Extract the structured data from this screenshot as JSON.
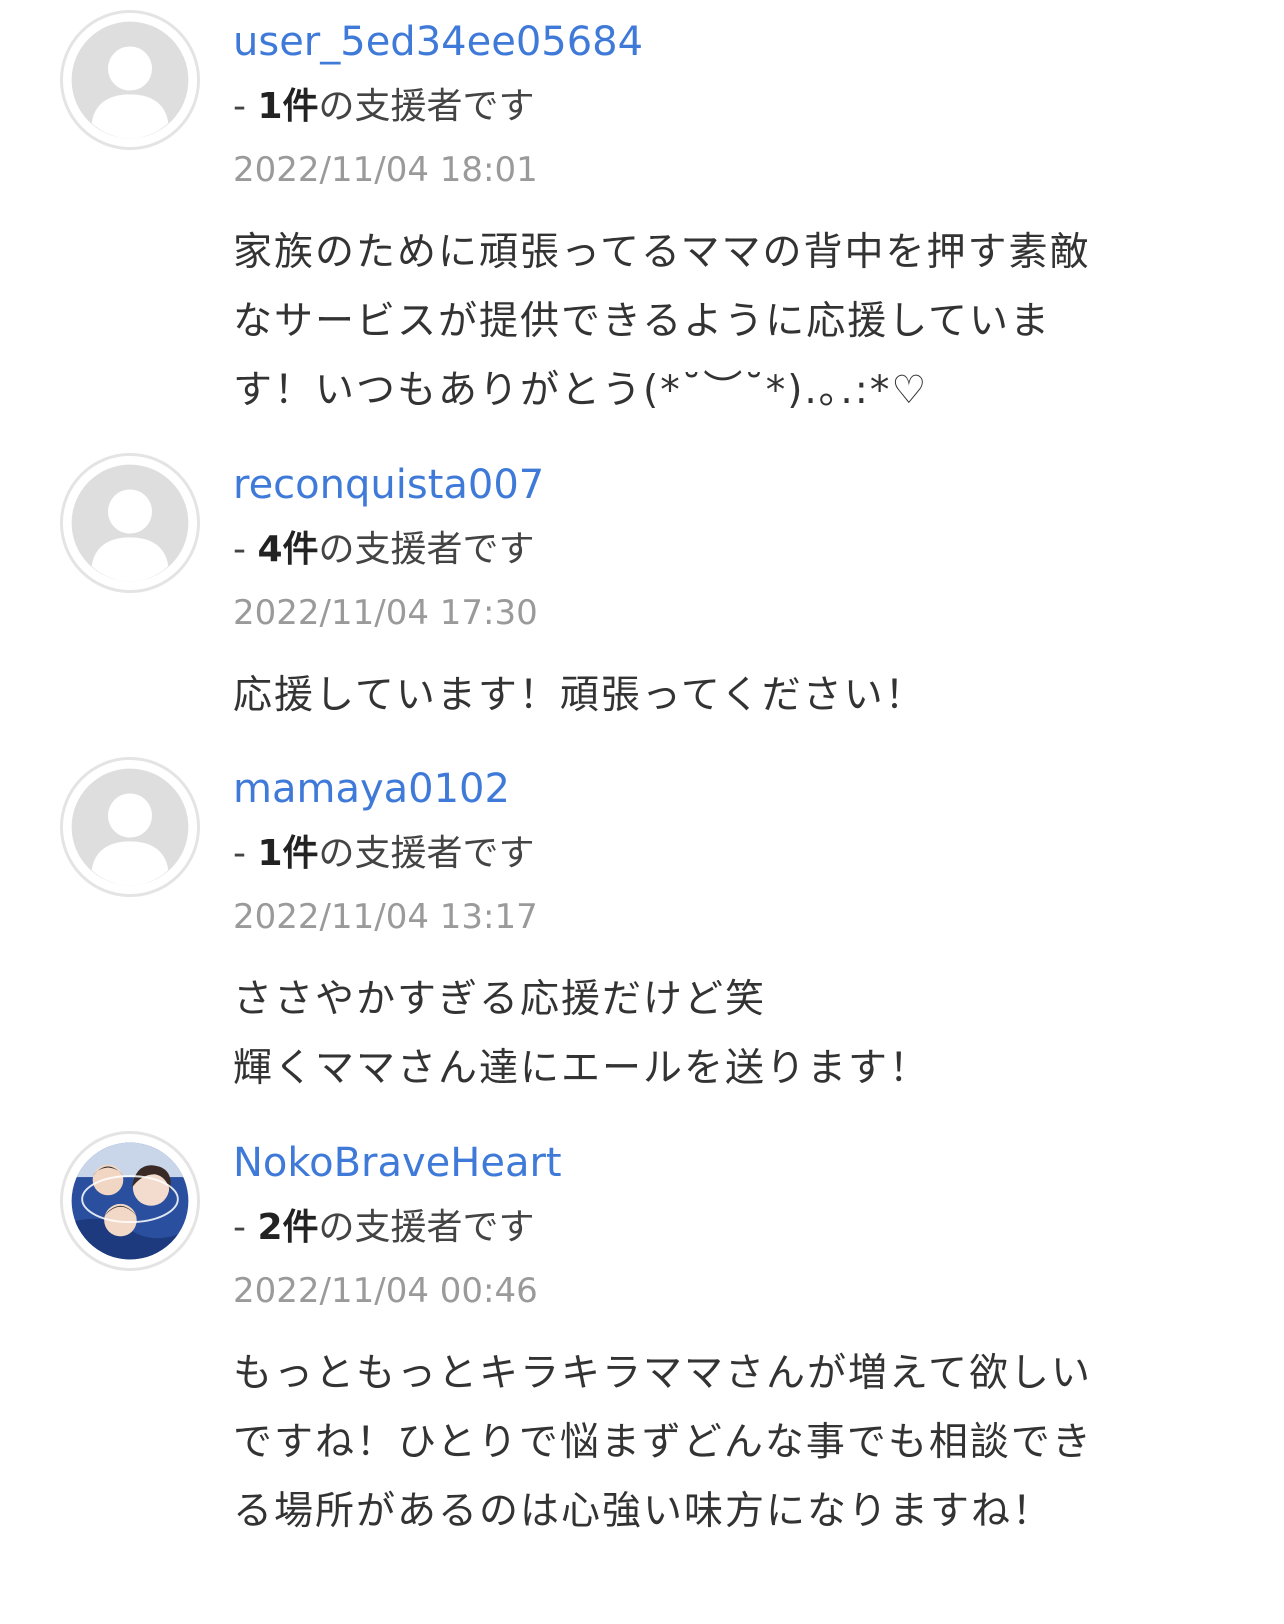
{
  "comments": [
    {
      "username": "user_5ed34ee05684",
      "supporter_prefix": "- ",
      "supporter_count": "1件",
      "supporter_suffix": "の支援者です",
      "timestamp": "2022/11/04 18:01",
      "avatar": "default-user-icon",
      "lines": [
        "家族のために頑張ってるママの背中を押す素敵",
        "なサービスが提供できるように応援していま",
        "す！いつもありがとう(*˘︶˘*).｡.:*♡"
      ]
    },
    {
      "username": "reconquista007",
      "supporter_prefix": "- ",
      "supporter_count": "4件",
      "supporter_suffix": "の支援者です",
      "timestamp": "2022/11/04 17:30",
      "avatar": "default-user-icon",
      "lines": [
        "応援しています！頑張ってください！"
      ]
    },
    {
      "username": "mamaya0102",
      "supporter_prefix": "- ",
      "supporter_count": "1件",
      "supporter_suffix": "の支援者です",
      "timestamp": "2022/11/04 13:17",
      "avatar": "default-user-icon",
      "lines": [
        "ささやかすぎる応援だけど笑",
        "輝くママさん達にエールを送ります！"
      ]
    },
    {
      "username": "NokoBraveHeart",
      "supporter_prefix": "- ",
      "supporter_count": "2件",
      "supporter_suffix": "の支援者です",
      "timestamp": "2022/11/04 00:46",
      "avatar": "family-photo",
      "lines": [
        "もっともっとキラキラママさんが増えて欲しい",
        "ですね！ひとりで悩まずどんな事でも相談でき",
        "る場所があるのは心強い味方になりますね！"
      ]
    }
  ],
  "colors": {
    "username": "#3f7ad9",
    "timestamp": "#9a9a9a",
    "text": "#333333",
    "avatar_border": "#e4e4e4",
    "avatar_placeholder": "#dedede"
  }
}
